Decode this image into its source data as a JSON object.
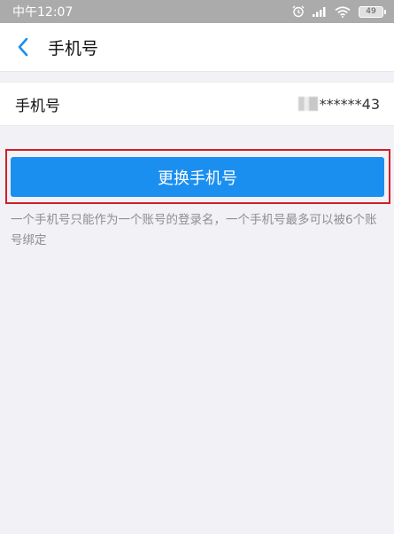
{
  "status_bar": {
    "time": "中午12:07",
    "battery": "49"
  },
  "nav": {
    "title": "手机号"
  },
  "phone_row": {
    "label": "手机号",
    "masked_value": "******43"
  },
  "action": {
    "button_label": "更换手机号"
  },
  "hint": {
    "text": "一个手机号只能作为一个账号的登录名，一个手机号最多可以被6个账号绑定"
  },
  "colors": {
    "accent": "#1b8ff0",
    "highlight_border": "#d21f26",
    "status_bar": "#ababab",
    "background": "#f2f1f6"
  }
}
